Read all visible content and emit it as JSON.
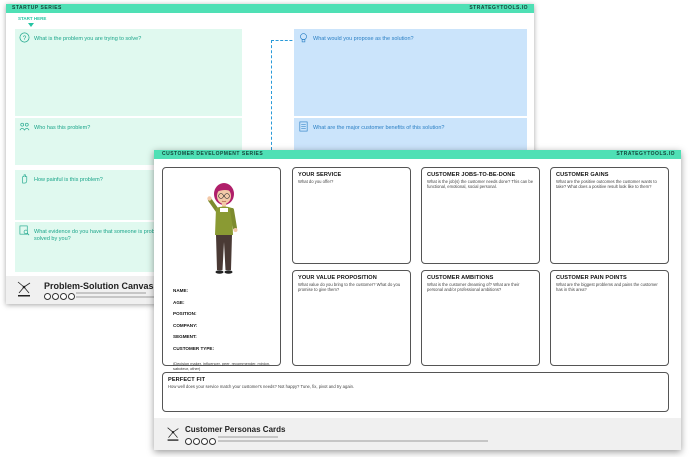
{
  "back_sheet": {
    "series": "STARTUP SERIES",
    "brand": "STRATEGYTOOLS.IO",
    "start_here": "START HERE",
    "problem_q": "What is the problem you are trying to solve?",
    "who_q": "Who has this problem?",
    "painful_q": "How painful is this problem?",
    "evidence_q": "What evidence do you have that someone is problem solved by you?",
    "solution_q": "What would you propose as the solution?",
    "benefits_q": "What are the major customer benefits of this solution?",
    "footer_title": "Problem-Solution Canvas"
  },
  "front_sheet": {
    "series": "CUSTOMER DEVELOPMENT SERIES",
    "brand": "STRATEGYTOOLS.IO",
    "persona": {
      "fields": [
        "NAME:",
        "AGE:",
        "POSITION:",
        "COMPANY:",
        "SEGMENT:",
        "CUSTOMER TYPE:"
      ],
      "note": "(Decision maker, influencer, peer, recommender, minion, saboteur, other)"
    },
    "cards": {
      "service": {
        "title": "YOUR SERVICE",
        "desc": "What do you offer?"
      },
      "jobs": {
        "title": "CUSTOMER JOBS-TO-BE-DONE",
        "desc": "What is the job(s) the customer needs done? This can be functional, emotional, social personal."
      },
      "gains": {
        "title": "CUSTOMER GAINS",
        "desc": "What are the positive outcomes the customer wants to take? What does a positive result look like to them?"
      },
      "value": {
        "title": "YOUR VALUE PROPOSITION",
        "desc": "What value do you bring to the customer? What do you promise to give them?"
      },
      "ambitions": {
        "title": "CUSTOMER AMBITIONS",
        "desc": "What is the customer dreaming of? What are their personal and/or professional ambitions?"
      },
      "pains": {
        "title": "CUSTOMER PAIN POINTS",
        "desc": "What are the biggest problems and pains the customer has in this area?"
      },
      "fit": {
        "title": "PERFECT FIT",
        "desc": "How well does your service match your customer's needs? Not happy? Tune, fix, pivot and try again."
      }
    },
    "footer_title": "Customer Personas Cards"
  },
  "colors": {
    "accent": "#4fe0b5",
    "green_panel": "#e0f9ef",
    "blue_panel": "#cbe4fb",
    "green_text": "#1aa58a",
    "blue_text": "#2a7fc4"
  },
  "icons": [
    "question-icon",
    "people-icon",
    "hand-icon",
    "magnifier-icon",
    "lightbulb-icon",
    "document-icon",
    "strategytools-logo",
    "creative-commons-icon",
    "persona-illustration"
  ]
}
